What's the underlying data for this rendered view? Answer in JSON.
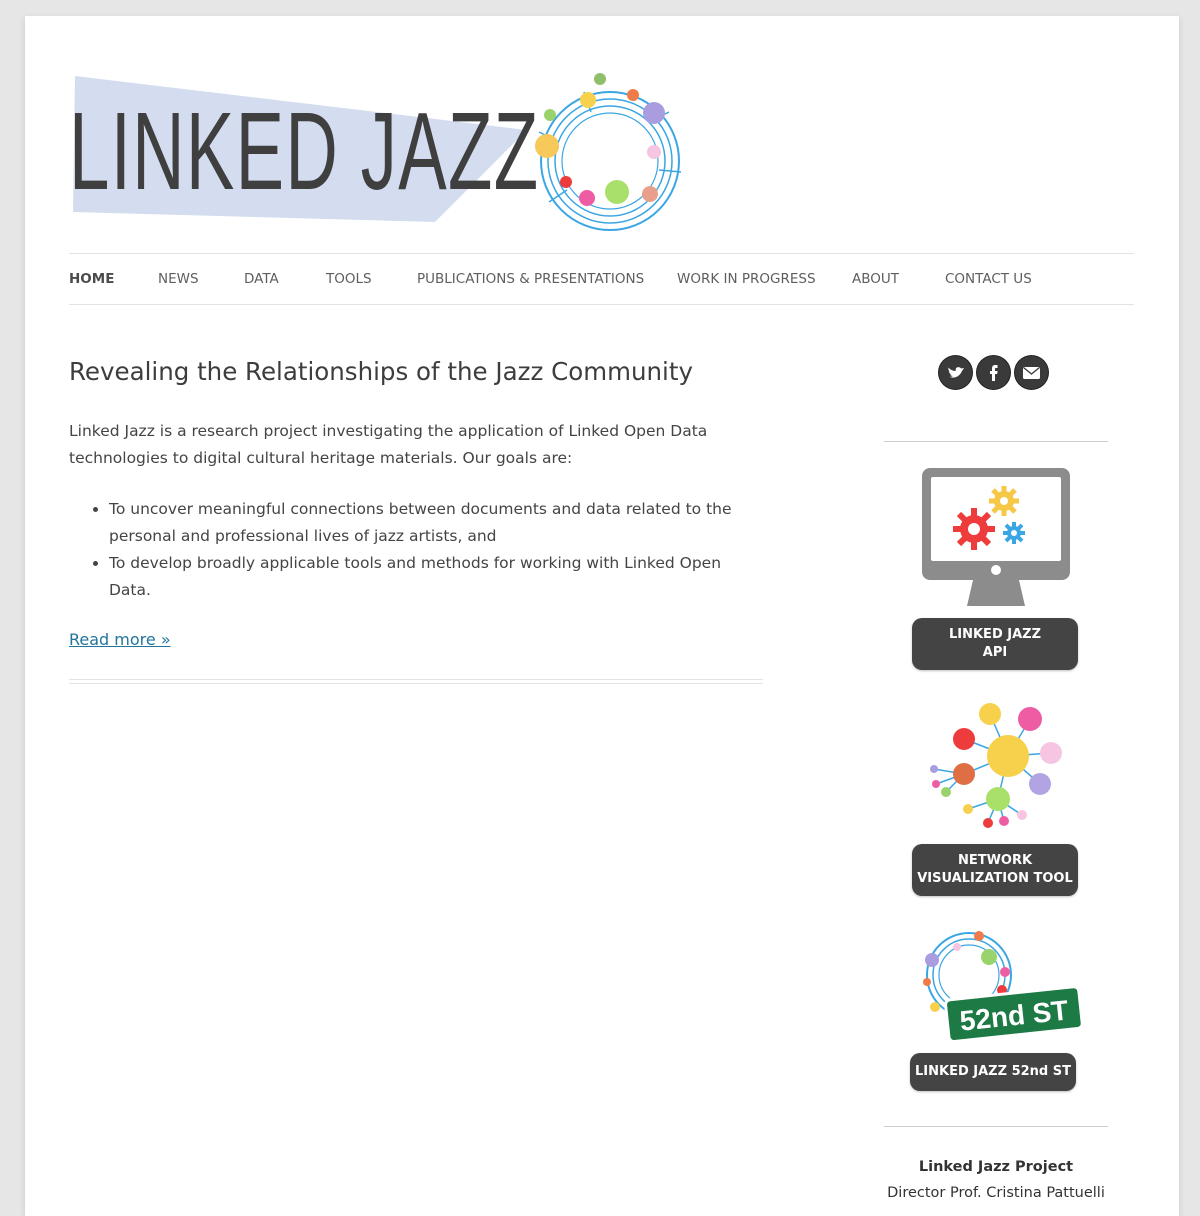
{
  "site": {
    "logo_text": "LINKED JAZZ"
  },
  "nav": {
    "items": [
      {
        "label": "HOME"
      },
      {
        "label": "NEWS"
      },
      {
        "label": "DATA"
      },
      {
        "label": "TOOLS"
      },
      {
        "label": "PUBLICATIONS & PRESENTATIONS"
      },
      {
        "label": "WORK IN PROGRESS"
      },
      {
        "label": "ABOUT"
      },
      {
        "label": "CONTACT US"
      }
    ],
    "active": "HOME"
  },
  "article": {
    "title": "Revealing the Relationships of the Jazz Community",
    "intro": "Linked Jazz is a research project investigating the application of Linked Open Data technologies to digital cultural heritage materials. Our goals are:",
    "goals": [
      "To uncover meaningful connections between documents and data related to the personal and professional lives of jazz artists, and",
      "To develop broadly applicable tools and methods for working with Linked Open Data."
    ],
    "read_more": "Read more »"
  },
  "sidebar": {
    "social": [
      {
        "icon": "twitter-icon"
      },
      {
        "icon": "facebook-icon"
      },
      {
        "icon": "email-icon"
      }
    ],
    "widgets": [
      {
        "label": "LINKED JAZZ\nAPI",
        "icon": "monitor-gears-icon"
      },
      {
        "label": "NETWORK\nVISUALIZATION TOOL",
        "icon": "network-graph-icon"
      },
      {
        "label": "LINKED JAZZ 52nd ST",
        "icon": "52nd-st-sign-icon",
        "sign_text": "52nd ST"
      }
    ],
    "project": {
      "title": "Linked Jazz Project",
      "director": "Director Prof. Cristina Pattuelli"
    }
  },
  "colors": {
    "link": "#21759b",
    "pill": "#444444",
    "logo_band": "#d3ddef",
    "ring": "#3aa6e4",
    "sign_green": "#1d7a45"
  }
}
